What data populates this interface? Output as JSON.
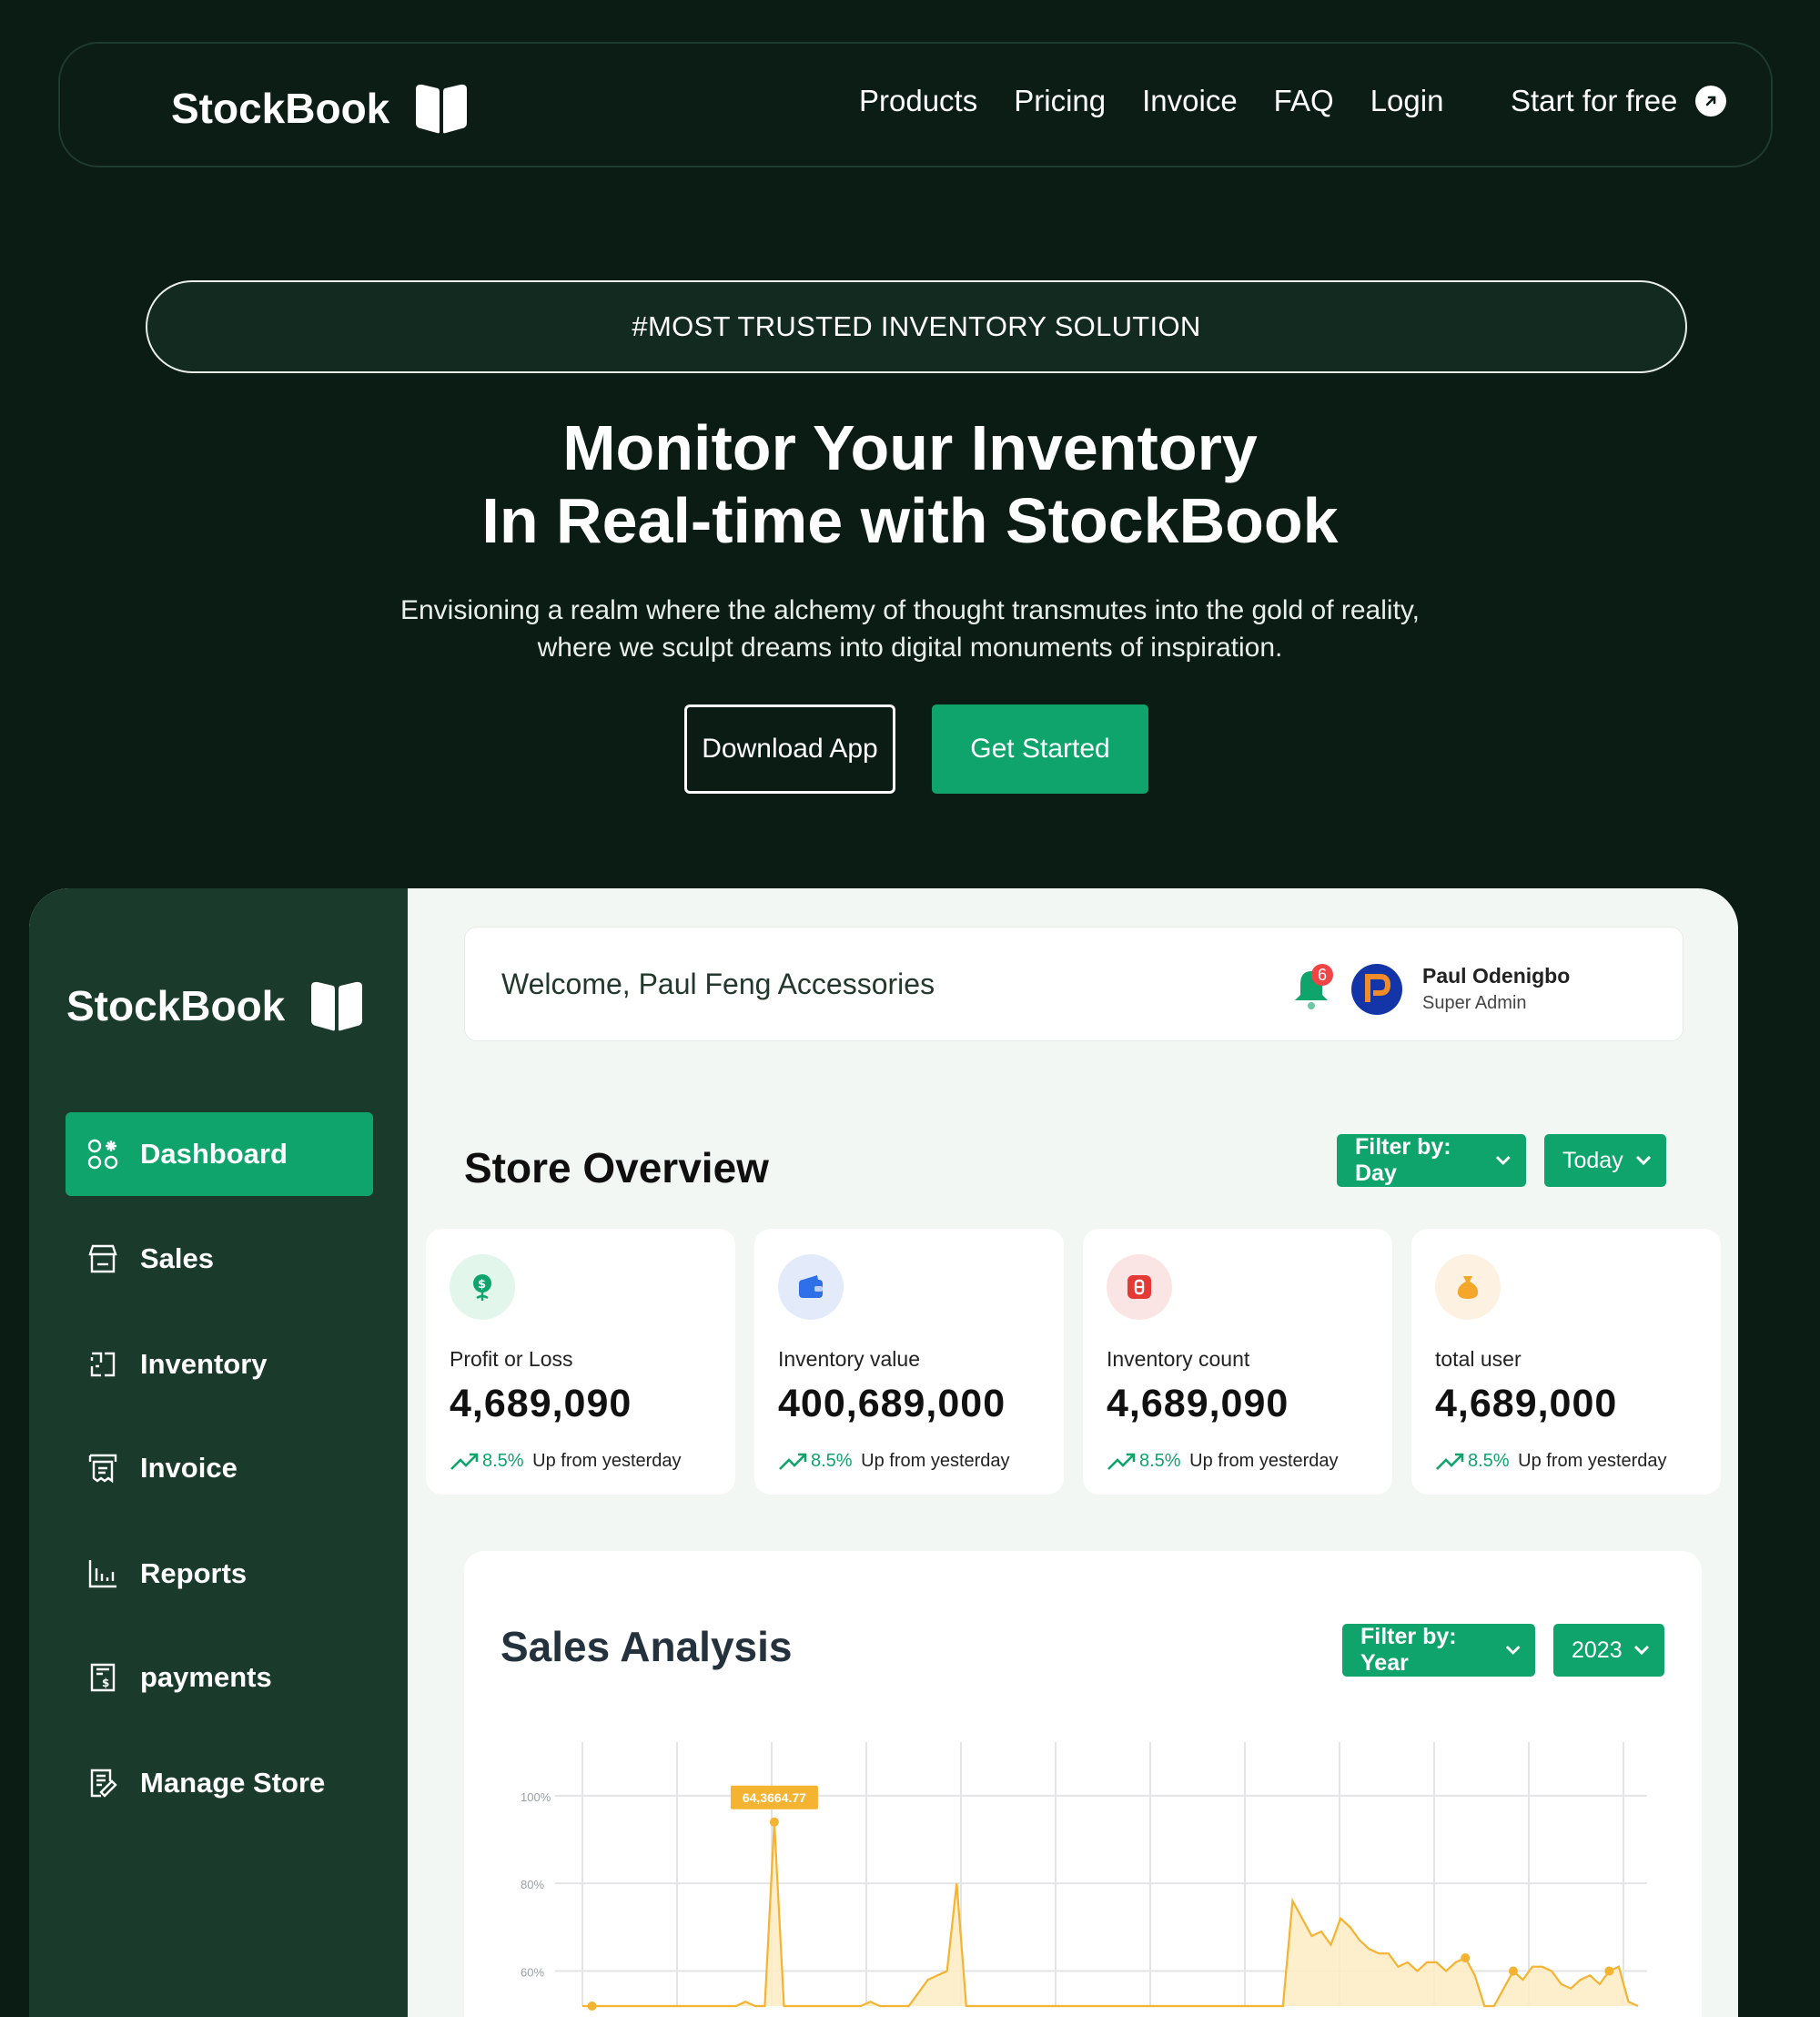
{
  "brand": {
    "name": "StockBook"
  },
  "nav": {
    "links": [
      "Products",
      "Pricing",
      "Invoice",
      "FAQ",
      "Login"
    ],
    "cta": "Start for free"
  },
  "hero": {
    "tag": "#MOST TRUSTED INVENTORY SOLUTION",
    "title_line1": "Monitor Your Inventory",
    "title_line2": "In Real-time with StockBook",
    "sub_line1": "Envisioning a realm where the alchemy of thought transmutes into the gold of reality,",
    "sub_line2": "where we sculpt dreams into digital monuments of inspiration.",
    "download": "Download App",
    "get_started": "Get Started"
  },
  "sidebar": {
    "items": [
      {
        "label": "Dashboard",
        "icon": "dashboard-grid-icon",
        "active": true
      },
      {
        "label": "Sales",
        "icon": "store-icon"
      },
      {
        "label": "Inventory",
        "icon": "inventory-icon"
      },
      {
        "label": "Invoice",
        "icon": "invoice-icon"
      },
      {
        "label": "Reports",
        "icon": "bar-chart-icon"
      },
      {
        "label": "payments",
        "icon": "receipt-icon"
      },
      {
        "label": "Manage Store",
        "icon": "edit-document-icon"
      }
    ]
  },
  "header": {
    "welcome": "Welcome, Paul Feng Accessories",
    "notifications": "6",
    "user_name": "Paul Odenigbo",
    "user_role": "Super Admin"
  },
  "overview": {
    "title": "Store Overview",
    "filter": "Filter by: Day",
    "period": "Today",
    "stats": [
      {
        "label": "Profit or Loss",
        "value": "4,689,090",
        "pct": "8.5%",
        "trend": "Up from yesterday",
        "icon": "money-plant-icon",
        "color": "#0ea46b",
        "bg": "#e2f6ec"
      },
      {
        "label": "Inventory value",
        "value": "400,689,000",
        "pct": "8.5%",
        "trend": "Up from yesterday",
        "icon": "wallet-icon",
        "color": "#2f6fe8",
        "bg": "#e3ebfb"
      },
      {
        "label": "Inventory count",
        "value": "4,689,090",
        "pct": "8.5%",
        "trend": "Up from yesterday",
        "icon": "box-icon",
        "color": "#e53935",
        "bg": "#fbe4e4"
      },
      {
        "label": "total user",
        "value": "4,689,000",
        "pct": "8.5%",
        "trend": "Up from yesterday",
        "icon": "money-bag-icon",
        "color": "#f4a72a",
        "bg": "#fdf1e1"
      }
    ]
  },
  "sales": {
    "title": "Sales Analysis",
    "filter": "Filter by: Year",
    "year": "2023"
  },
  "chart_data": {
    "type": "area",
    "yticks": [
      "100%",
      "80%",
      "60%"
    ],
    "ylim": [
      52,
      106
    ],
    "tooltip": {
      "text": "64,3664.77",
      "point_index": 20
    },
    "color": "#f4b331",
    "values": [
      50,
      50,
      50,
      50,
      51,
      52,
      50,
      50,
      50,
      50,
      50,
      50,
      50,
      50,
      50,
      50,
      50,
      53,
      50,
      50,
      94,
      50,
      50,
      50,
      50,
      52,
      51,
      50,
      50,
      50,
      53,
      50,
      50,
      50,
      52,
      55,
      58,
      59,
      60,
      80,
      52,
      50,
      50,
      50,
      50,
      50,
      50,
      51,
      50,
      51,
      51,
      50,
      50,
      50,
      50,
      50,
      50,
      50,
      50,
      50,
      50,
      50,
      50,
      50,
      50,
      50,
      50,
      50,
      50,
      50,
      50,
      50,
      50,
      50,
      76,
      72,
      68,
      69,
      66,
      72,
      70,
      67,
      65,
      64,
      64,
      61,
      62,
      60,
      62,
      62,
      60,
      62,
      63,
      59,
      52,
      50,
      56,
      60,
      58,
      61,
      61,
      60,
      57,
      56,
      58,
      59,
      57,
      60,
      61,
      53,
      52
    ],
    "marked_points": [
      1,
      20,
      92,
      97,
      107
    ]
  }
}
